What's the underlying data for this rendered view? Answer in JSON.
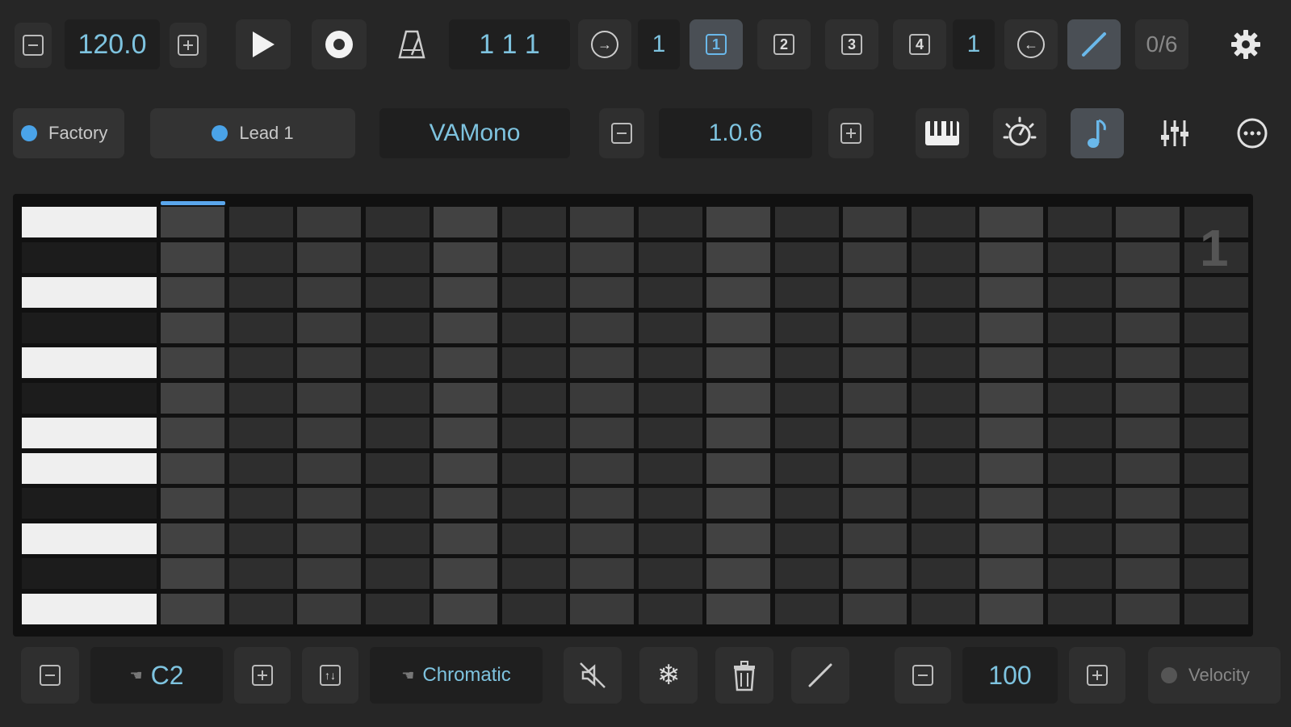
{
  "transport": {
    "tempo": "120.0",
    "position": "1 1  1",
    "loop_length": "1",
    "patterns": [
      "1",
      "2",
      "3",
      "4"
    ],
    "pattern_count": "1",
    "step_status": "0/6"
  },
  "preset": {
    "bank": "Factory",
    "patch": "Lead 1",
    "instrument": "VAMono",
    "version": "1.0.6"
  },
  "grid": {
    "pattern_label": "1",
    "rows": 12,
    "columns": 16,
    "keys": [
      "white",
      "black",
      "white",
      "black",
      "white",
      "black",
      "white",
      "white",
      "black",
      "white",
      "black",
      "white"
    ]
  },
  "bottom": {
    "root_note": "C2",
    "scale": "Chromatic",
    "velocity_value": "100",
    "velocity_label": "Velocity"
  },
  "colors": {
    "accent": "#7ec3df",
    "highlight": "#4aa3e8",
    "background": "#262626"
  }
}
